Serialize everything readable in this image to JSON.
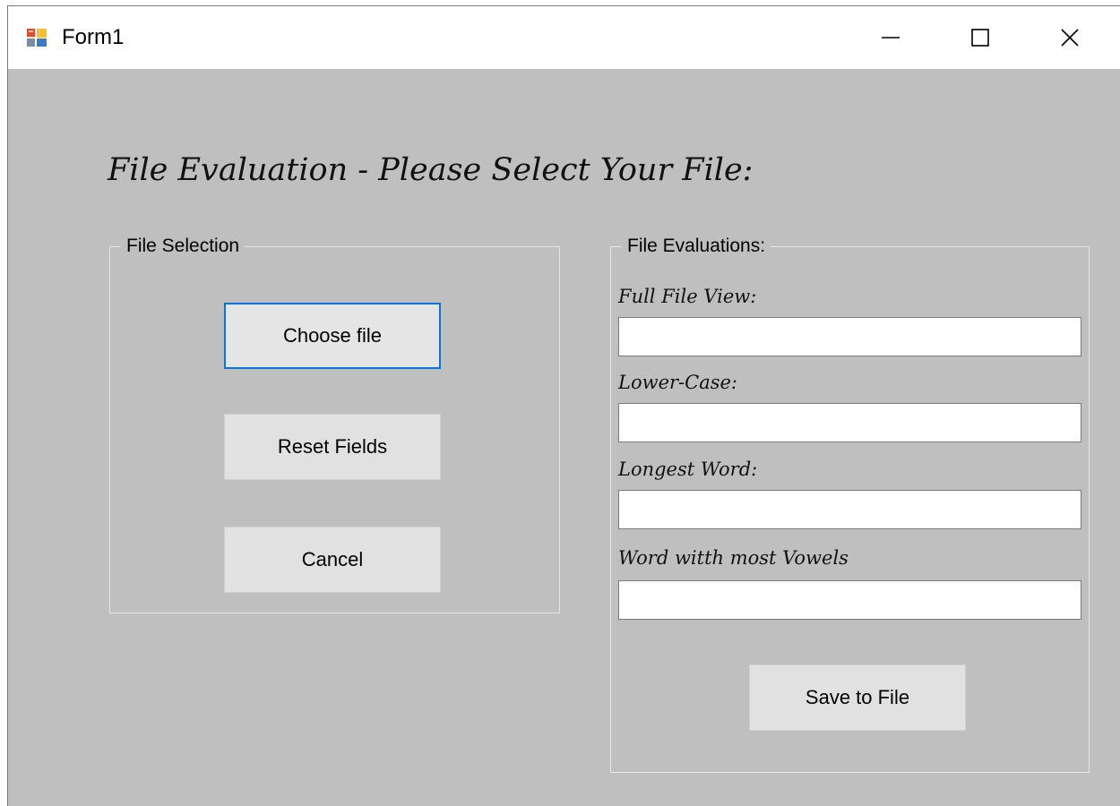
{
  "window": {
    "title": "Form1"
  },
  "main": {
    "heading": "File Evaluation - Please Select Your File:"
  },
  "file_selection": {
    "legend": "File Selection",
    "choose_label": "Choose file",
    "reset_label": "Reset Fields",
    "cancel_label": "Cancel"
  },
  "file_evaluations": {
    "legend": "File Evaluations:",
    "fields": [
      {
        "label": "Full File View:",
        "value": ""
      },
      {
        "label": "Lower-Case:",
        "value": ""
      },
      {
        "label": "Longest Word:",
        "value": ""
      },
      {
        "label": "Word witth most Vowels",
        "value": ""
      }
    ],
    "save_label": "Save to File"
  },
  "icons": {
    "app": "winforms-app-icon",
    "minimize": "minimize-icon",
    "maximize": "maximize-icon",
    "close": "close-icon"
  },
  "colors": {
    "form_background": "#bfbfbf",
    "focus_border": "#0a74d6",
    "button_face": "#e1e1e1"
  }
}
